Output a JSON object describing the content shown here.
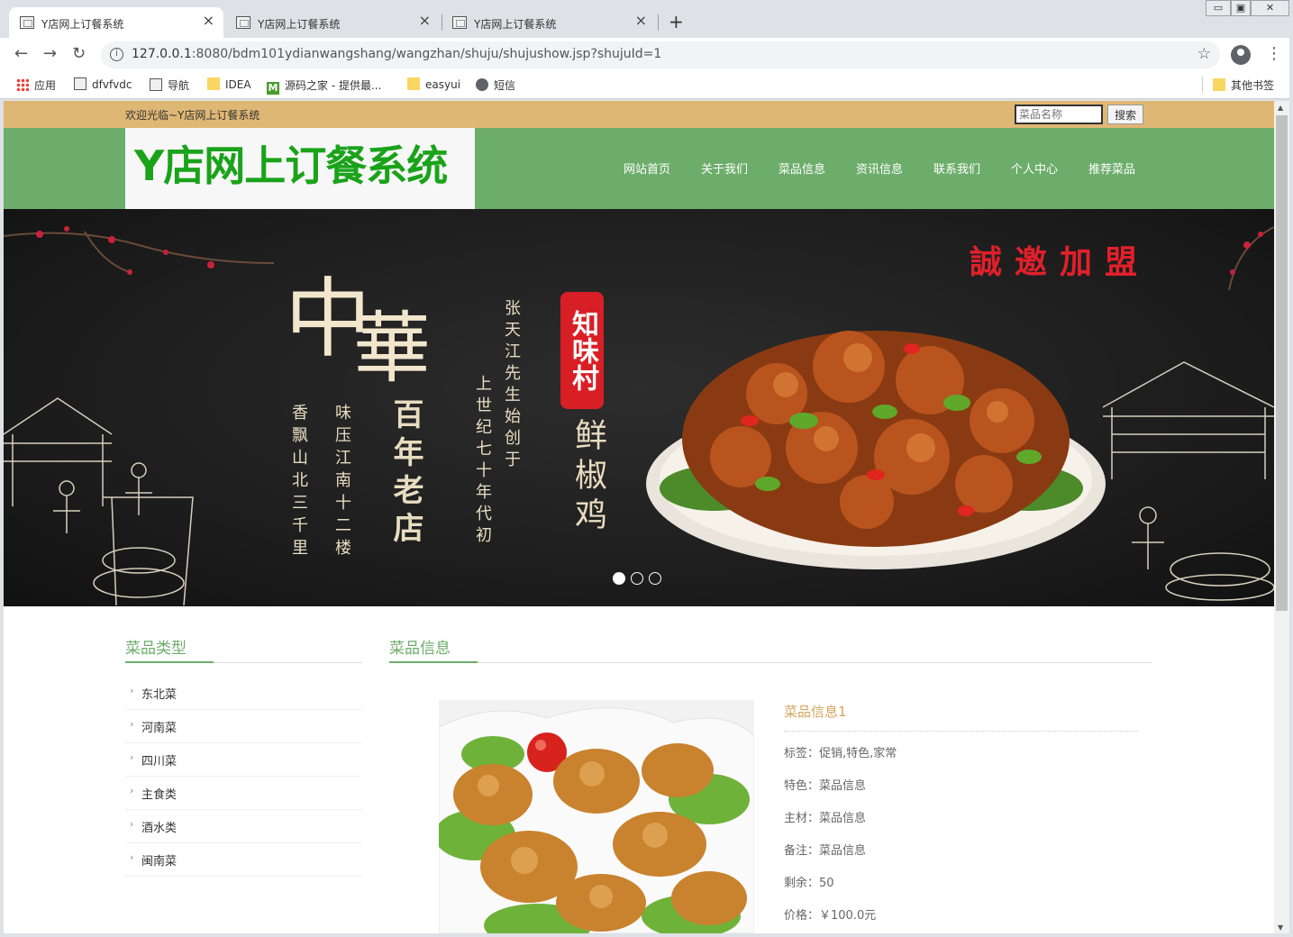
{
  "browser": {
    "tabs": [
      {
        "title": "Y店网上订餐系统",
        "active": true
      },
      {
        "title": "Y店网上订餐系统",
        "active": false
      },
      {
        "title": "Y店网上订餐系统",
        "active": false
      }
    ],
    "new_tab": "+",
    "url_host": "127.0.0.1",
    "url_rest": ":8080/bdm101ydianwangshang/wangzhan/shuju/shujushow.jsp?shujuId=1",
    "bookmarks": [
      {
        "label": "应用",
        "icon": "apps-icon"
      },
      {
        "label": "dfvfvdc",
        "icon": "page-icon"
      },
      {
        "label": "导航",
        "icon": "page-icon"
      },
      {
        "label": "IDEA",
        "icon": "folder-icon"
      },
      {
        "label": "源码之家 - 提供最...",
        "icon": "m-icon"
      },
      {
        "label": "easyui",
        "icon": "folder-icon"
      },
      {
        "label": "短信",
        "icon": "globe-icon"
      }
    ],
    "other_bookmarks": "其他书签"
  },
  "site": {
    "welcome": "欢迎光临~Y店网上订餐系统",
    "search_placeholder": "菜品名称",
    "search_button": "搜索",
    "logo": "Y店网上订餐系统",
    "nav": [
      "网站首页",
      "关于我们",
      "菜品信息",
      "资讯信息",
      "联系我们",
      "个人中心",
      "推荐菜品"
    ],
    "colors": {
      "topbar": "#dfb774",
      "header": "#6dad6b",
      "logo": "#1aa31a",
      "accent": "#6dad6b",
      "detail_title": "#d4a35a"
    }
  },
  "banner": {
    "headline_1": "中",
    "headline_2": "華",
    "column_a": "张天江先生始创于",
    "column_b": "上世纪七十年代初",
    "column_c": "百年老店",
    "column_d": "味压江南十二楼",
    "column_e": "香飘山北三千里",
    "seal": "知味村",
    "dish_name": "鲜椒鸡",
    "join": "誠邀加盟",
    "slides": 3,
    "active_slide": 1
  },
  "sidebar": {
    "title": "菜品类型",
    "categories": [
      "东北菜",
      "河南菜",
      "四川菜",
      "主食类",
      "酒水类",
      "闽南菜"
    ]
  },
  "main": {
    "title": "菜品信息",
    "item_title": "菜品信息1",
    "fields": [
      "标签：促销,特色,家常",
      "特色：菜品信息",
      "主材：菜品信息",
      "备注：菜品信息",
      "剩余：50",
      "价格：￥100.0元"
    ]
  }
}
